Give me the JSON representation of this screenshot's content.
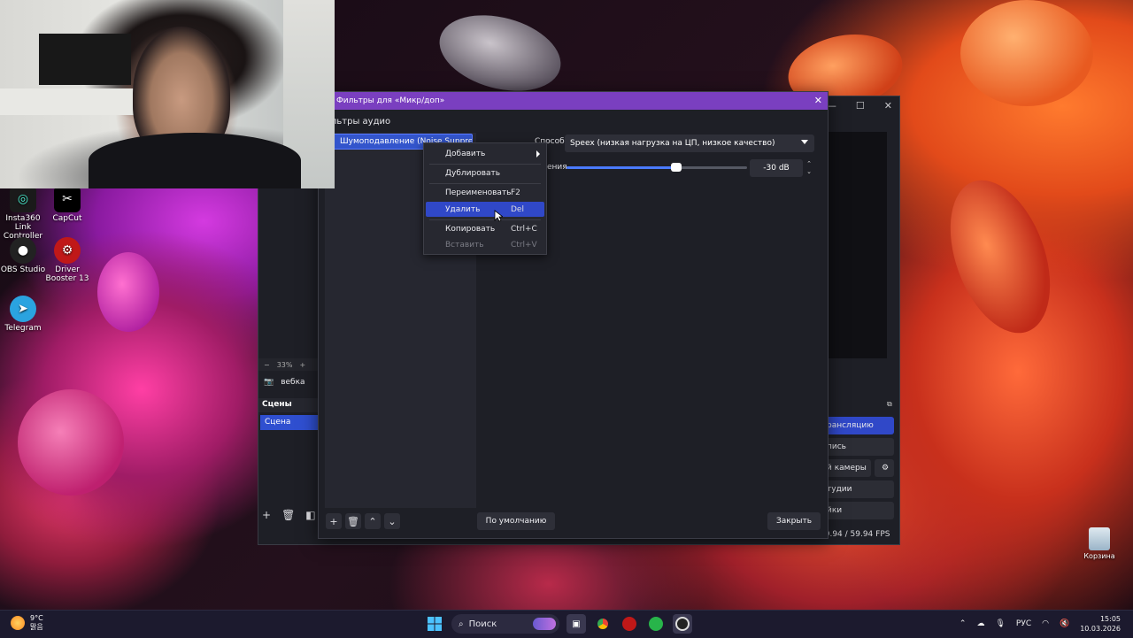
{
  "desktop": {
    "icons": [
      {
        "label": "Insta360 Link Controller",
        "glyph": "◎"
      },
      {
        "label": "CapCut",
        "glyph": "✂"
      },
      {
        "label": "OBS Studio",
        "glyph": "●"
      },
      {
        "label": "Driver Booster 13",
        "glyph": "⚙"
      },
      {
        "label": "Telegram",
        "glyph": "➤"
      }
    ],
    "recycle_bin": "Корзина"
  },
  "obs_main": {
    "zoom": {
      "minus": "−",
      "value": "33%",
      "plus": "+"
    },
    "source_name": "вебка",
    "scenes_header": "Сцены",
    "scene_item": "Сцена",
    "controls": [
      "рансляцию",
      "пись",
      "й камеры",
      "тудии",
      "йки"
    ],
    "fps": "59.94 / 59.94 FPS"
  },
  "filters_dialog": {
    "title": "Фильтры для «Микр/доп»",
    "audio_filters_label": "льтры аудио",
    "filter_item": "Шумоподавление (Noise Suppres",
    "method_label": "Способ",
    "method_value": "Speex (низкая нагрузка на ЦП, низкое качество)",
    "level_label": "ения",
    "level_value": "-30 dB",
    "level_fraction": 0.61,
    "defaults_button": "По умолчанию",
    "close_button": "Закрыть"
  },
  "context_menu": {
    "items": [
      {
        "label": "Добавить",
        "shortcut": "",
        "submenu": true,
        "state": "normal"
      },
      {
        "label": "Дублировать",
        "shortcut": "",
        "state": "normal"
      },
      {
        "label": "Переименовать",
        "shortcut": "F2",
        "state": "normal"
      },
      {
        "label": "Удалить",
        "shortcut": "Del",
        "state": "highlighted"
      },
      {
        "label": "Копировать",
        "shortcut": "Ctrl+C",
        "state": "normal"
      },
      {
        "label": "Вставить",
        "shortcut": "Ctrl+V",
        "state": "disabled"
      }
    ]
  },
  "taskbar": {
    "weather_temp": "9°C",
    "weather_desc": "맑음",
    "search_label": "Поиск",
    "language": "РУС",
    "time": "15:05",
    "date": "10.03.2026"
  },
  "colors": {
    "accent": "#3048c8",
    "dialog_title": "#7a3fc0",
    "panel_bg": "#1e1f26"
  }
}
